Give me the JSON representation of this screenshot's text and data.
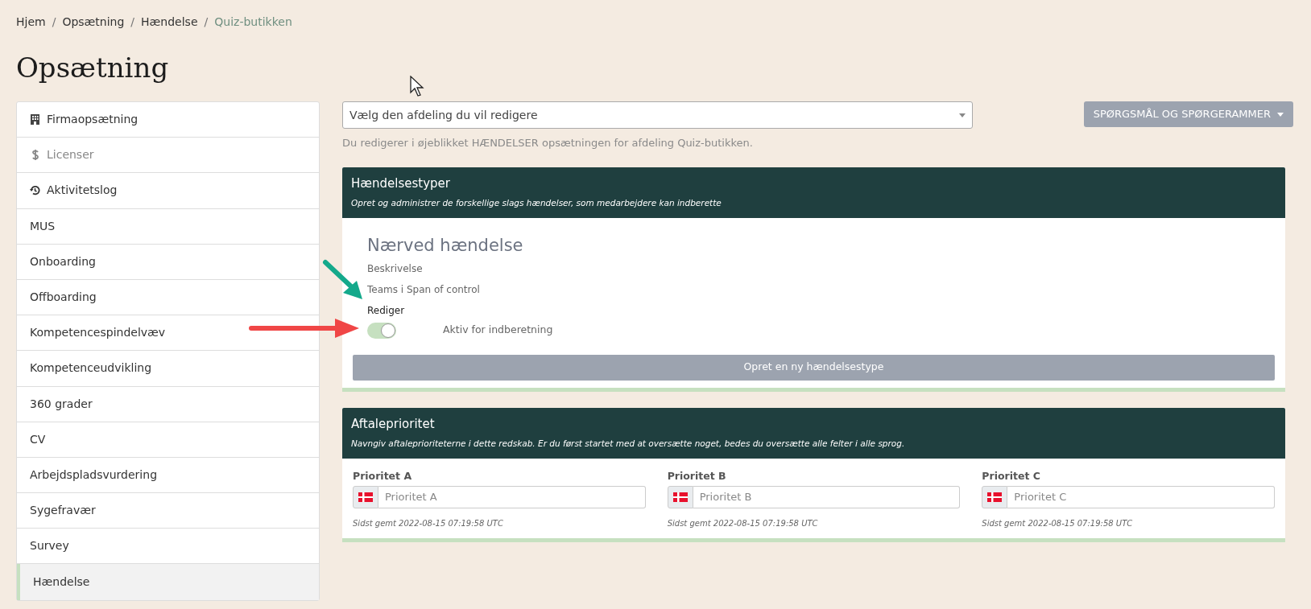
{
  "breadcrumb": [
    {
      "label": "Hjem",
      "current": false
    },
    {
      "label": "Opsætning",
      "current": false
    },
    {
      "label": "Hændelse",
      "current": false
    },
    {
      "label": "Quiz-butikken",
      "current": true
    }
  ],
  "breadcrumb_separators": [
    "/",
    "/",
    "/"
  ],
  "page_title": "Opsætning",
  "sidebar": {
    "items": [
      {
        "label": "Firmaopsætning",
        "kind": "building",
        "disabled": false,
        "selected": false
      },
      {
        "label": "Licenser",
        "kind": "dollar",
        "disabled": true,
        "selected": false
      },
      {
        "label": "Aktivitetslog",
        "kind": "history",
        "disabled": false,
        "selected": false
      },
      {
        "label": "MUS",
        "kind": "plain",
        "disabled": false,
        "selected": false
      },
      {
        "label": "Onboarding",
        "kind": "plain",
        "disabled": false,
        "selected": false
      },
      {
        "label": "Offboarding",
        "kind": "plain",
        "disabled": false,
        "selected": false
      },
      {
        "label": "Kompetencespindelvæv",
        "kind": "plain",
        "disabled": false,
        "selected": false
      },
      {
        "label": "Kompetenceudvikling",
        "kind": "plain",
        "disabled": false,
        "selected": false
      },
      {
        "label": "360 grader",
        "kind": "plain",
        "disabled": false,
        "selected": false
      },
      {
        "label": "CV",
        "kind": "plain",
        "disabled": false,
        "selected": false
      },
      {
        "label": "Arbejdspladsvurdering",
        "kind": "plain",
        "disabled": false,
        "selected": false
      },
      {
        "label": "Sygefravær",
        "kind": "plain",
        "disabled": false,
        "selected": false
      },
      {
        "label": "Survey",
        "kind": "plain",
        "disabled": false,
        "selected": false
      },
      {
        "label": "Hændelse",
        "kind": "plain",
        "disabled": false,
        "selected": true
      }
    ]
  },
  "department_select": {
    "value": "Vælg den afdeling du vil redigere"
  },
  "questions_button": "SPØRGSMÅL OG SPØRGERAMMER",
  "info_text": "Du redigerer i øjeblikket HÆNDELSER opsætningen for afdeling Quiz-butikken.",
  "event_types": {
    "title": "Hændelsestyper",
    "subtitle": "Opret og administrer de forskellige slags hændelser, som medarbejdere kan indberette",
    "items": [
      {
        "name": "Nærved hændelse",
        "description": "Beskrivelse",
        "teams": "Teams i Span of control",
        "edit_link": "Rediger",
        "active": true,
        "active_label": "Aktiv for indberetning"
      }
    ],
    "create_button": "Opret en ny hændelsestype"
  },
  "priorities": {
    "title": "Aftaleprioritet",
    "subtitle": "Navngiv aftaleprioriteterne i dette redskab. Er du først startet med at oversætte noget, bedes du oversætte alle felter i alle sprog.",
    "fields": [
      {
        "label": "Prioritet A",
        "placeholder": "Prioritet A",
        "saved": "Sidst gemt 2022-08-15 07:19:58 UTC"
      },
      {
        "label": "Prioritet B",
        "placeholder": "Prioritet B",
        "saved": "Sidst gemt 2022-08-15 07:19:58 UTC"
      },
      {
        "label": "Prioritet C",
        "placeholder": "Prioritet C",
        "saved": "Sidst gemt 2022-08-15 07:19:58 UTC"
      }
    ]
  }
}
